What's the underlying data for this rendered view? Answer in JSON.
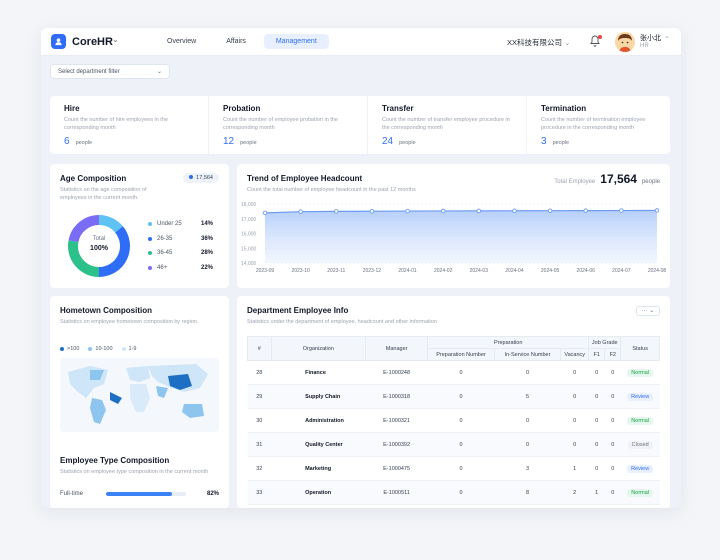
{
  "app": {
    "name": "CoreHR"
  },
  "nav": {
    "tabs": [
      {
        "label": "Overview"
      },
      {
        "label": "Affairs"
      },
      {
        "label": "Management"
      }
    ],
    "active": "Management"
  },
  "header": {
    "company": "XX科技有限公司",
    "user_name": "张小北",
    "user_role": "HR"
  },
  "filter": {
    "placeholder": "Select department filter"
  },
  "stats": [
    {
      "title": "Hire",
      "desc": "Count the number of hire employees in the corresponding month",
      "value": "6",
      "unit": "people"
    },
    {
      "title": "Probation",
      "desc": "Count the number of employee probation in the corresponding month",
      "value": "12",
      "unit": "people"
    },
    {
      "title": "Transfer",
      "desc": "Count the number of transfer employee procedure in the corresponding month",
      "value": "24",
      "unit": "people"
    },
    {
      "title": "Termination",
      "desc": "Count the number of termination employee procedure in the corresponding month",
      "value": "3",
      "unit": "people"
    }
  ],
  "age": {
    "title": "Age Composition",
    "subtitle": "Statistics on the age composition of employees in the current month.",
    "badge": "17,564",
    "center_label": "Total",
    "center_value": "100%",
    "segments": [
      {
        "label": "Under 25",
        "value": "14%",
        "color": "#5ec3f2"
      },
      {
        "label": "26-35",
        "value": "36%",
        "color": "#2f6df6"
      },
      {
        "label": "36-45",
        "value": "28%",
        "color": "#2cc08a"
      },
      {
        "label": "46+",
        "value": "22%",
        "color": "#7b6cf6"
      }
    ]
  },
  "trend": {
    "title": "Trend of Employee Headcount",
    "subtitle": "Count the total number of employee headcount in the past 12 months",
    "total_label": "Total Employee",
    "total_value": "17,564",
    "total_unit": "people"
  },
  "chart_data": {
    "type": "area",
    "title": "Trend of Employee Headcount",
    "x": [
      "2023-09",
      "2023-10",
      "2023-11",
      "2023-12",
      "2024-01",
      "2024-02",
      "2024-03",
      "2024-04",
      "2024-05",
      "2024-06",
      "2024-07",
      "2024-08"
    ],
    "values": [
      17400,
      17480,
      17500,
      17510,
      17520,
      17530,
      17535,
      17540,
      17545,
      17550,
      17555,
      17564
    ],
    "ylim": [
      14000,
      18000
    ],
    "yticks": [
      "18,000",
      "17,000",
      "16,000",
      "15,000",
      "14,000"
    ],
    "grid": true
  },
  "hometown": {
    "title": "Hometown Composition",
    "subtitle": "Statistics on employee hometown composition by region.",
    "legend": [
      {
        "label": ">100",
        "color": "#1d6fc4"
      },
      {
        "label": "10-100",
        "color": "#8ec5ef"
      },
      {
        "label": "1-9",
        "color": "#cfe5f8"
      }
    ]
  },
  "emptype": {
    "title": "Employee Type Composition",
    "subtitle": "Statistics on employee type composition in the current month",
    "rows": [
      {
        "label": "Full-time",
        "value": "82%",
        "ratio": 0.82
      }
    ]
  },
  "dept": {
    "title": "Department Employee Info",
    "subtitle": "Statistics under the department of employee, headcount and other information",
    "more_label": "···",
    "headers": {
      "no": "#",
      "org": "Organization",
      "manager": "Manager",
      "preparation": "Preparation",
      "prep_num": "Preparation Number",
      "in_service": "In-Service Number",
      "vacancy": "Vacancy",
      "job_grade": "Job Grade",
      "f1": "F1",
      "f2": "F2",
      "status": "Status"
    },
    "rows": [
      {
        "no": "28",
        "org": "Finance",
        "manager": "E-1000248",
        "prep": "0",
        "inservice": "0",
        "vacancy": "0",
        "f1": "0",
        "f2": "0",
        "status": "Normal",
        "kind": "normal"
      },
      {
        "no": "29",
        "org": "Supply Chain",
        "manager": "E-1000318",
        "prep": "0",
        "inservice": "5",
        "vacancy": "0",
        "f1": "0",
        "f2": "0",
        "status": "Review",
        "kind": "review"
      },
      {
        "no": "30",
        "org": "Administration",
        "manager": "E-1000321",
        "prep": "0",
        "inservice": "0",
        "vacancy": "0",
        "f1": "0",
        "f2": "0",
        "status": "Normal",
        "kind": "normal"
      },
      {
        "no": "31",
        "org": "Quality Center",
        "manager": "E-1000392",
        "prep": "0",
        "inservice": "0",
        "vacancy": "0",
        "f1": "0",
        "f2": "0",
        "status": "Closed",
        "kind": "closed"
      },
      {
        "no": "32",
        "org": "Marketing",
        "manager": "E-1000475",
        "prep": "0",
        "inservice": "3",
        "vacancy": "1",
        "f1": "0",
        "f2": "0",
        "status": "Review",
        "kind": "review"
      },
      {
        "no": "33",
        "org": "Operation",
        "manager": "E-1000511",
        "prep": "0",
        "inservice": "8",
        "vacancy": "2",
        "f1": "1",
        "f2": "0",
        "status": "Normal",
        "kind": "normal"
      }
    ]
  }
}
